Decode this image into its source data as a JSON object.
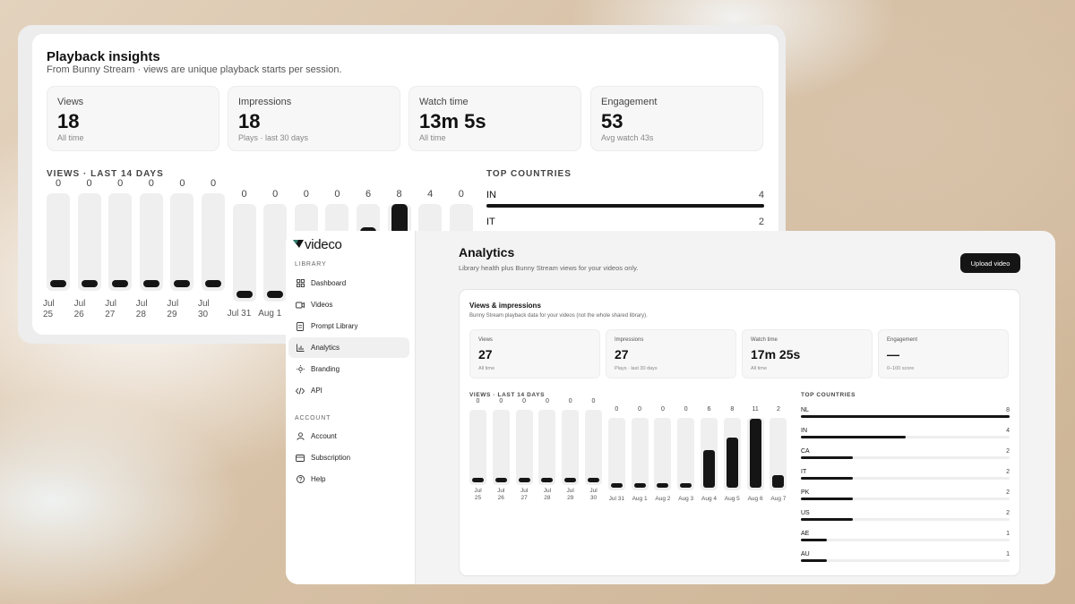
{
  "back_card": {
    "title": "Playback insights",
    "subtitle": "From Bunny Stream · views are unique playback starts per session.",
    "stats": [
      {
        "label": "Views",
        "value": "18",
        "hint": "All time"
      },
      {
        "label": "Impressions",
        "value": "18",
        "hint": "Plays · last 30 days"
      },
      {
        "label": "Watch time",
        "value": "13m 5s",
        "hint": "All time"
      },
      {
        "label": "Engagement",
        "value": "53",
        "hint": "Avg watch 43s"
      }
    ],
    "views_label": "VIEWS · LAST 14 DAYS",
    "countries_label": "TOP COUNTRIES",
    "countries": [
      {
        "code": "IN",
        "count": "4",
        "share": 1.0
      },
      {
        "code": "IT",
        "count": "2",
        "share": 0.5
      }
    ]
  },
  "app": {
    "brand": "videco",
    "sidebar": {
      "library_heading": "LIBRARY",
      "library_items": [
        {
          "label": "Dashboard",
          "icon": "grid-icon"
        },
        {
          "label": "Videos",
          "icon": "video-icon"
        },
        {
          "label": "Prompt Library",
          "icon": "document-icon"
        },
        {
          "label": "Analytics",
          "icon": "bar-chart-icon"
        },
        {
          "label": "Branding",
          "icon": "sun-icon"
        },
        {
          "label": "API",
          "icon": "code-icon"
        }
      ],
      "account_heading": "ACCOUNT",
      "account_items": [
        {
          "label": "Account",
          "icon": "user-icon"
        },
        {
          "label": "Subscription",
          "icon": "card-icon"
        },
        {
          "label": "Help",
          "icon": "help-circle-icon"
        }
      ]
    },
    "page_title": "Analytics",
    "page_subtitle": "Library health plus Bunny Stream views for your videos only.",
    "upload_label": "Upload video",
    "panel": {
      "title": "Views & impressions",
      "subtitle": "Bunny Stream playback data for your videos (not the whole shared library).",
      "stats": [
        {
          "label": "Views",
          "value": "27",
          "hint": "All time"
        },
        {
          "label": "Impressions",
          "value": "27",
          "hint": "Plays · last 30 days"
        },
        {
          "label": "Watch time",
          "value": "17m 25s",
          "hint": "All time"
        },
        {
          "label": "Engagement",
          "value": "—",
          "hint": "0–100 score"
        }
      ],
      "views_label": "VIEWS · LAST 14 DAYS",
      "countries_label": "TOP COUNTRIES",
      "countries": [
        {
          "code": "NL",
          "count": "8",
          "share": 1.0
        },
        {
          "code": "IN",
          "count": "4",
          "share": 0.5
        },
        {
          "code": "CA",
          "count": "2",
          "share": 0.25
        },
        {
          "code": "IT",
          "count": "2",
          "share": 0.25
        },
        {
          "code": "PK",
          "count": "2",
          "share": 0.25
        },
        {
          "code": "US",
          "count": "2",
          "share": 0.25
        },
        {
          "code": "AE",
          "count": "1",
          "share": 0.125
        },
        {
          "code": "AU",
          "count": "1",
          "share": 0.125
        }
      ]
    }
  },
  "chart_data": [
    {
      "type": "bar",
      "title": "VIEWS · LAST 14 DAYS",
      "categories": [
        "Jul 25",
        "Jul 26",
        "Jul 27",
        "Jul 28",
        "Jul 29",
        "Jul 30",
        "Jul 31",
        "Aug 1"
      ],
      "values": [
        0,
        0,
        0,
        0,
        0,
        0,
        0,
        0
      ],
      "ymax": 8
    },
    {
      "type": "bar",
      "title": "VIEWS · LAST 14 DAYS",
      "categories": [
        "Jul 25",
        "Jul 26",
        "Jul 27",
        "Jul 28",
        "Jul 29",
        "Jul 30",
        "Jul 31",
        "Aug 1",
        "Aug 2",
        "Aug 3",
        "Aug 4",
        "Aug 5",
        "Aug 6",
        "Aug 7"
      ],
      "values": [
        0,
        0,
        0,
        0,
        0,
        0,
        0,
        0,
        0,
        0,
        6,
        8,
        11,
        2
      ],
      "ymax": 11
    }
  ],
  "back_extra_counts": [
    "0",
    "0",
    "6",
    "8",
    "4",
    "0"
  ]
}
